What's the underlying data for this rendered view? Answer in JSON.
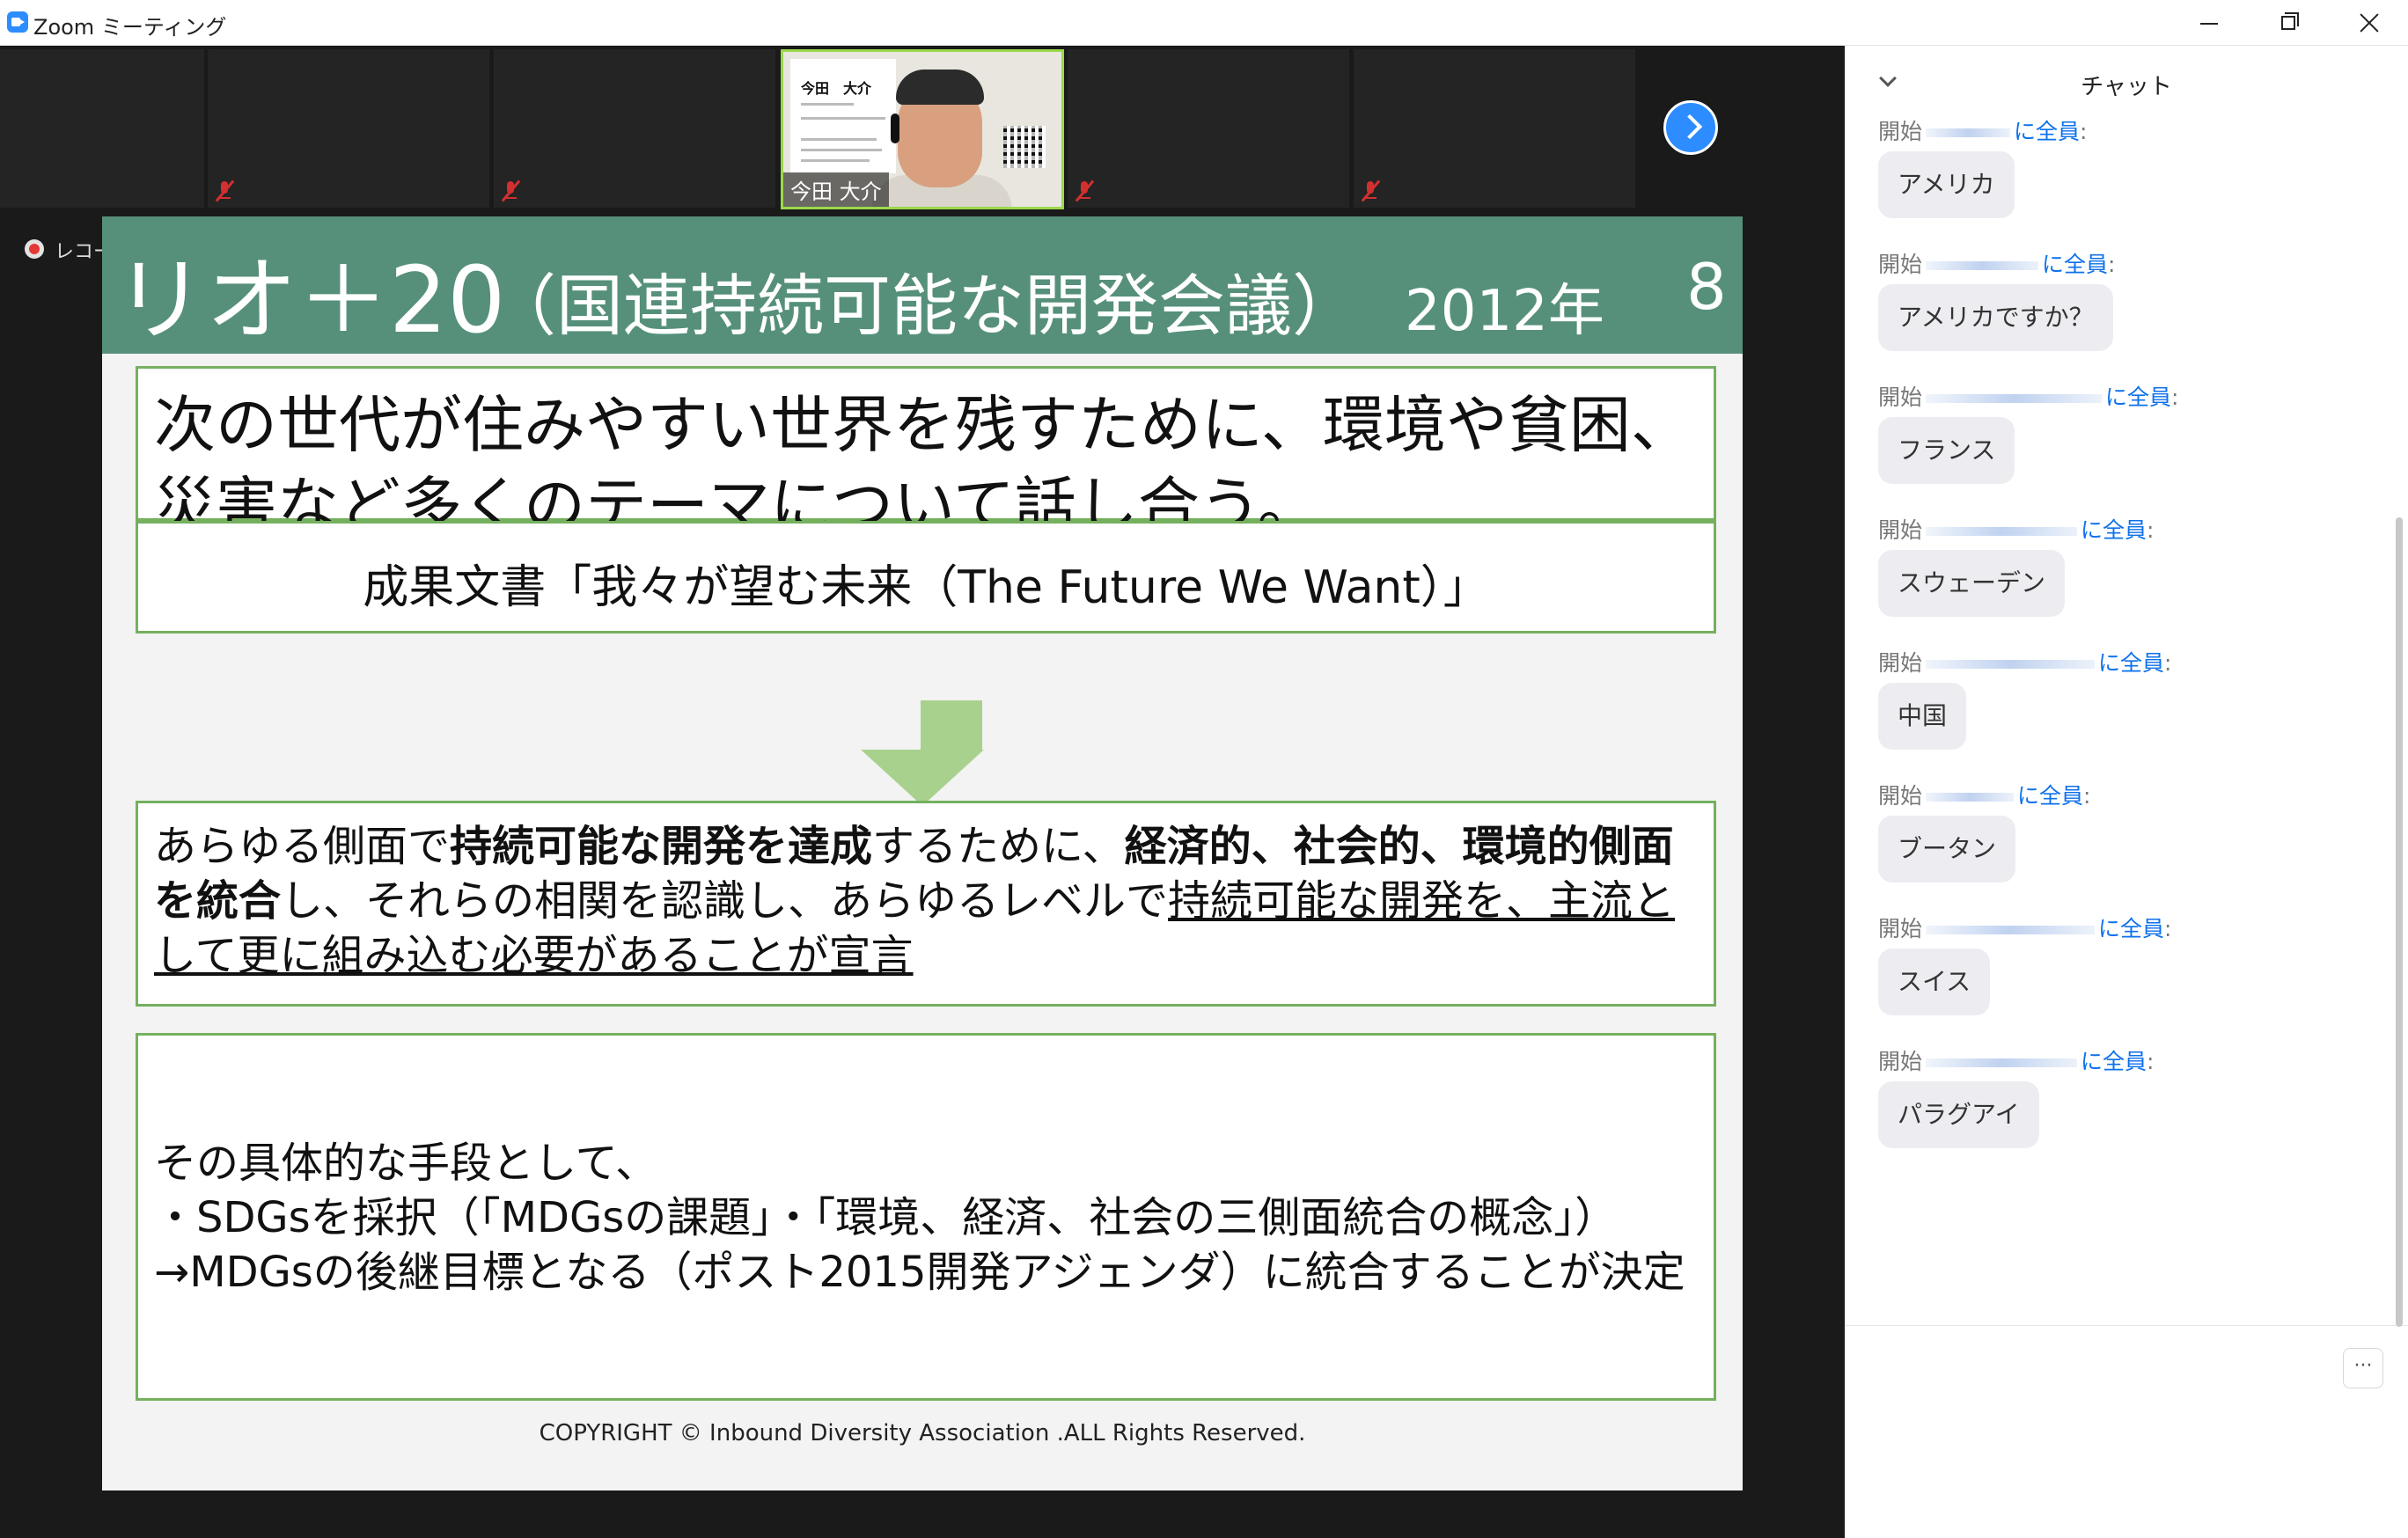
{
  "window": {
    "title": "Zoom ミーティング"
  },
  "video_strip": {
    "speaker_name": "今田 大介",
    "card_name": "今田　大介",
    "next_label": "›"
  },
  "recording": {
    "label": "レコーディング中"
  },
  "slide": {
    "title_main": "リオ＋20",
    "title_sub": "（国連持続可能な開発会議）",
    "year": "2012年",
    "number": "8",
    "box1_text": "次の世代が住みやすい世界を残すために、環境や貧困、災害など多くのテーマについて話し合う。",
    "box2_text": "成果文書「我々が望む未来（The Future We Want）」",
    "box3": {
      "p1": "あらゆる側面で",
      "b1": "持続可能な開発を達成",
      "p2": "するために、",
      "b2": "経済的、社会的、環境的側面を統合",
      "p3": "し、それらの相関を認識し、あらゆるレベルで",
      "u1": "持続可能な開発を、主流として更に組み込む必要があることが宣言"
    },
    "box4": {
      "line1": "その具体的な手段として、",
      "line2": "・SDGsを採択（「MDGsの課題」・「環境、経済、社会の三側面統合の概念」）",
      "line3": "→MDGsの後継目標となる（ポスト2015開発アジェンダ）に統合することが決定"
    },
    "copyright": "COPYRIGHT © Inbound Diversity Association .ALL Rights Reserved."
  },
  "chat": {
    "title": "チャット",
    "sender_prefix": "開始",
    "to_label": "に全員",
    "colon": ":",
    "messages": [
      {
        "text": "アメリカ"
      },
      {
        "text": "アメリカですか？"
      },
      {
        "text": "フランス"
      },
      {
        "text": "スウェーデン"
      },
      {
        "text": "中国"
      },
      {
        "text": "ブータン"
      },
      {
        "text": "スイス"
      },
      {
        "text": "パラグアイ"
      }
    ],
    "more_label": "···"
  }
}
